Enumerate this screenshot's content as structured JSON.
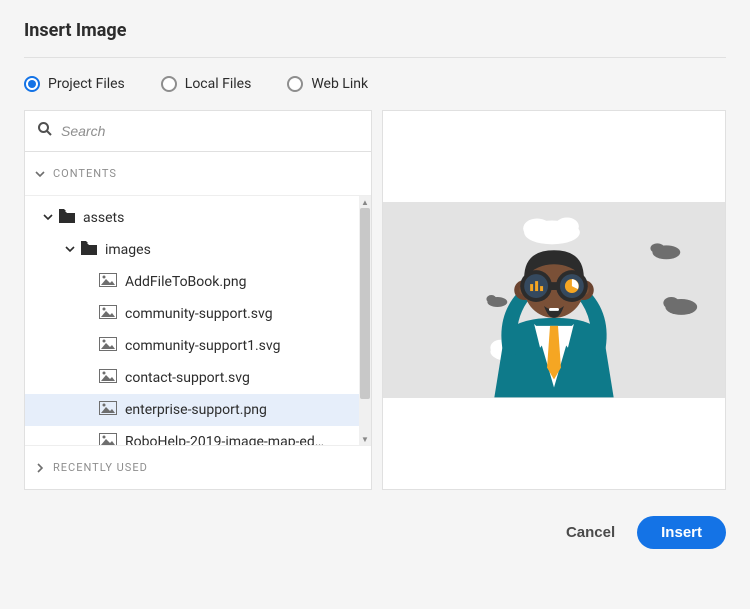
{
  "dialog": {
    "title": "Insert Image"
  },
  "tabs": {
    "project_files": "Project Files",
    "local_files": "Local Files",
    "web_link": "Web Link",
    "selected": "project_files"
  },
  "search": {
    "placeholder": "Search",
    "value": ""
  },
  "sidebar": {
    "contents_label": "CONTENTS",
    "recently_used_label": "RECENTLY USED"
  },
  "tree": {
    "folders": {
      "assets": "assets",
      "images": "images"
    },
    "files": [
      "AddFileToBook.png",
      "community-support.svg",
      "community-support1.svg",
      "contact-support.svg",
      "enterprise-support.png",
      "RoboHelp-2019-image-map-ed…"
    ],
    "selected_file": "enterprise-support.png"
  },
  "footer": {
    "cancel": "Cancel",
    "insert": "Insert"
  },
  "colors": {
    "accent": "#1473e6",
    "selection": "#e6eefa"
  }
}
